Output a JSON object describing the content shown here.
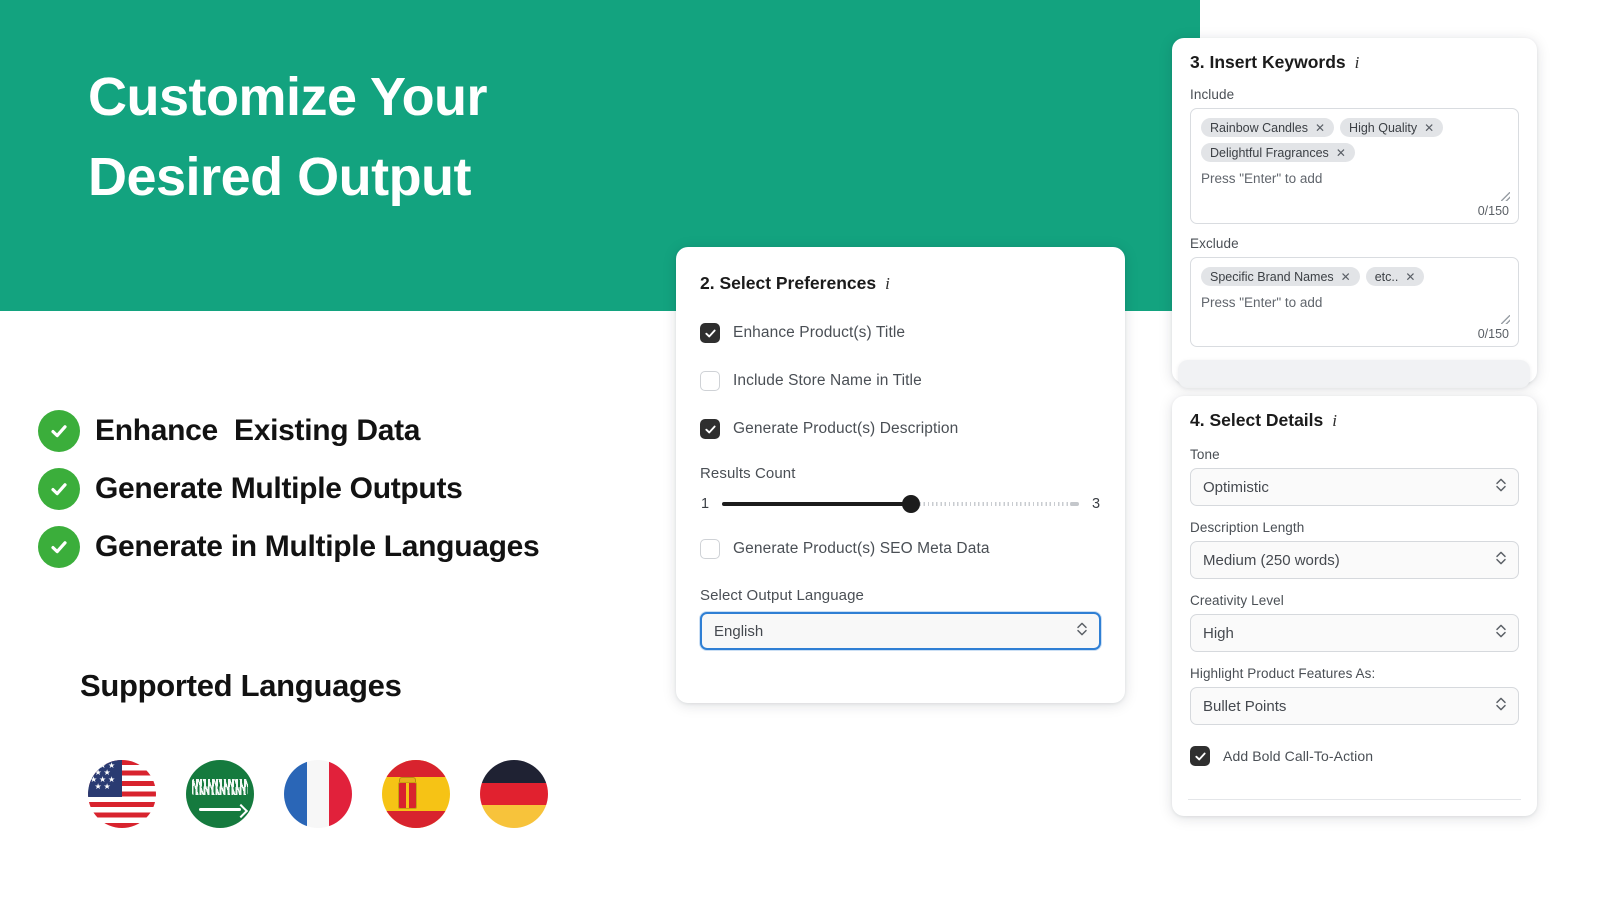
{
  "banner": {
    "title_line1": "Customize Your",
    "title_line2": "Desired Output",
    "bg_color": "#13a37f"
  },
  "features": {
    "check_color": "#3bae3b",
    "items": [
      {
        "label": "Enhance  Existing Data"
      },
      {
        "label": "Generate Multiple Outputs"
      },
      {
        "label": "Generate in Multiple Languages"
      }
    ]
  },
  "languages": {
    "heading": "Supported Languages",
    "flags": [
      {
        "name": "United States"
      },
      {
        "name": "Saudi Arabia"
      },
      {
        "name": "France"
      },
      {
        "name": "Spain"
      },
      {
        "name": "Germany"
      }
    ]
  },
  "preferences_card": {
    "title": "2. Select Preferences",
    "info_glyph": "i",
    "checkboxes": [
      {
        "label": "Enhance Product(s) Title",
        "checked": true
      },
      {
        "label": "Include Store Name in Title",
        "checked": false
      },
      {
        "label": "Generate Product(s) Description",
        "checked": true
      }
    ],
    "results_count": {
      "label": "Results Count",
      "min_label": "1",
      "max_label": "3",
      "value": 2,
      "fill_percent": 53
    },
    "seo_checkbox": {
      "label": "Generate Product(s) SEO Meta Data",
      "checked": false
    },
    "language_select": {
      "label": "Select Output Language",
      "value": "English",
      "focused": true,
      "focus_color": "#2f7fd4"
    }
  },
  "keywords_card": {
    "title": "3. Insert Keywords",
    "info_glyph": "i",
    "include": {
      "label": "Include",
      "tags": [
        "Rainbow Candles",
        "High Quality",
        "Delightful Fragrances"
      ],
      "placeholder": "Press \"Enter\" to add",
      "counter": "0/150",
      "remove_glyph": "✕"
    },
    "exclude": {
      "label": "Exclude",
      "tags": [
        "Specific Brand Names",
        "etc.."
      ],
      "placeholder": "Press \"Enter\" to add",
      "counter": "0/150",
      "remove_glyph": "✕"
    }
  },
  "details_card": {
    "title": "4. Select Details",
    "info_glyph": "i",
    "selects": [
      {
        "label": "Tone",
        "value": "Optimistic"
      },
      {
        "label": "Description Length",
        "value": "Medium (250 words)"
      },
      {
        "label": "Creativity Level",
        "value": "High"
      },
      {
        "label": "Highlight Product Features As:",
        "value": "Bullet Points"
      }
    ],
    "cta_checkbox": {
      "label": "Add Bold Call-To-Action",
      "checked": true
    }
  }
}
